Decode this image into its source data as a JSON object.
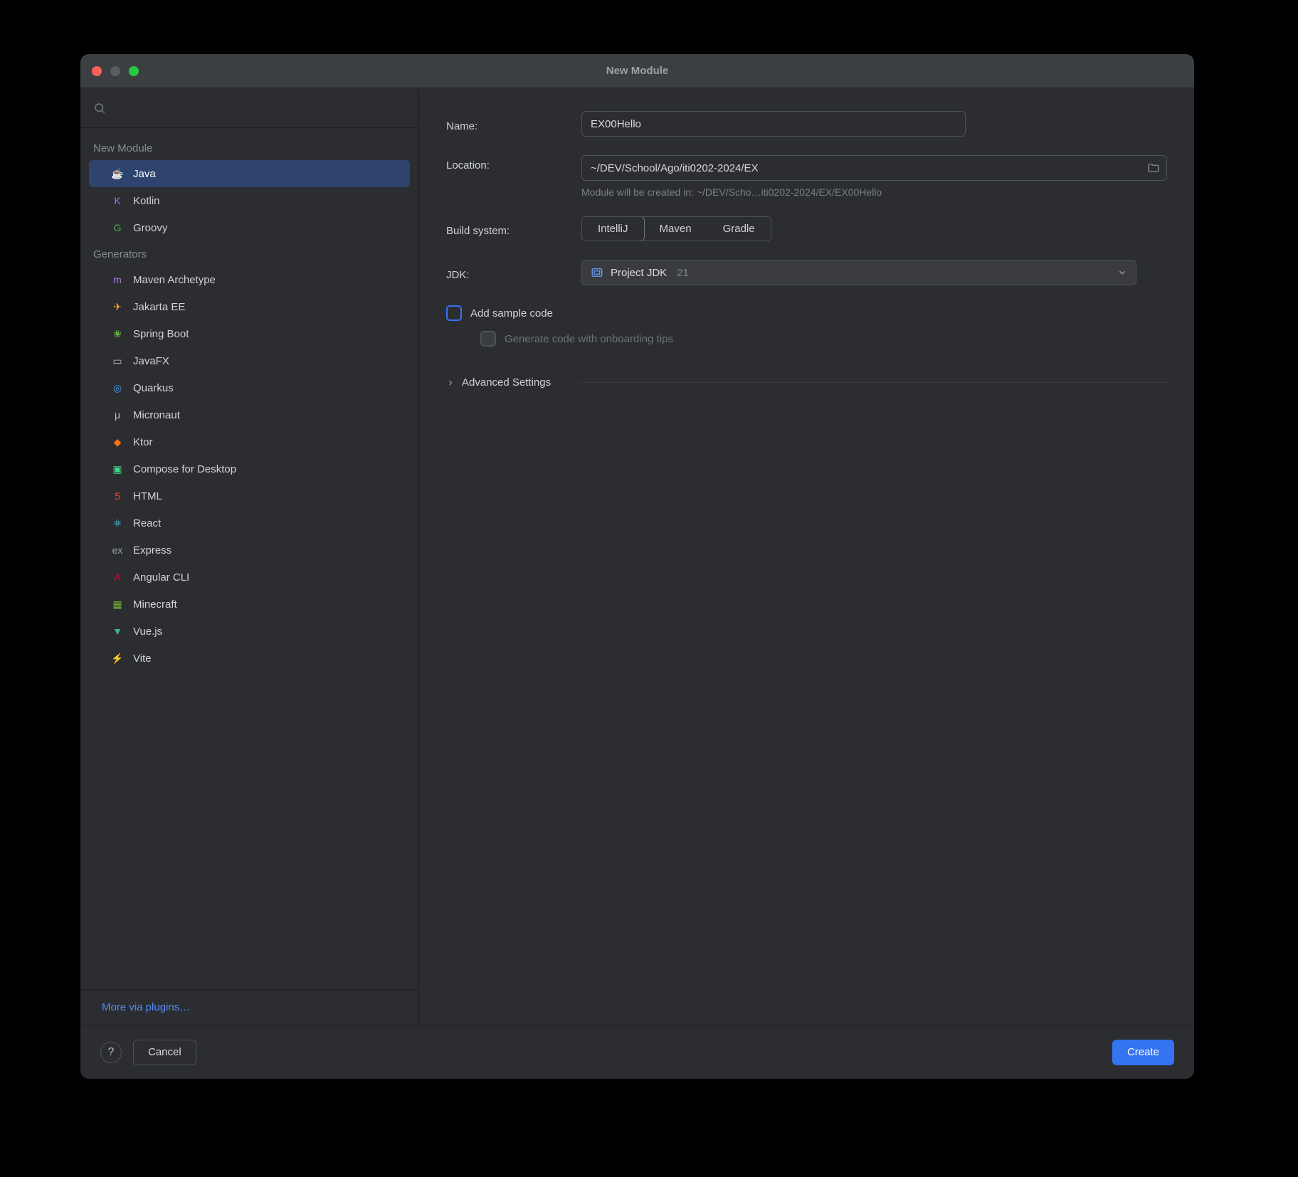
{
  "window": {
    "title": "New Module"
  },
  "sidebar": {
    "sections": [
      {
        "header": "New Module",
        "items": [
          {
            "label": "Java",
            "icon": "java-icon",
            "selected": true,
            "color": "#c97c4a"
          },
          {
            "label": "Kotlin",
            "icon": "kotlin-icon",
            "selected": false,
            "color": "#a86ff0"
          },
          {
            "label": "Groovy",
            "icon": "groovy-icon",
            "selected": false,
            "color": "#4caf50"
          }
        ]
      },
      {
        "header": "Generators",
        "items": [
          {
            "label": "Maven Archetype",
            "icon": "maven-icon",
            "selected": false,
            "color": "#b07bdf"
          },
          {
            "label": "Jakarta EE",
            "icon": "jakarta-icon",
            "selected": false,
            "color": "#f0a638"
          },
          {
            "label": "Spring Boot",
            "icon": "spring-icon",
            "selected": false,
            "color": "#6db33f"
          },
          {
            "label": "JavaFX",
            "icon": "javafx-icon",
            "selected": false,
            "color": "#bcbec4"
          },
          {
            "label": "Quarkus",
            "icon": "quarkus-icon",
            "selected": false,
            "color": "#4695eb"
          },
          {
            "label": "Micronaut",
            "icon": "micronaut-icon",
            "selected": false,
            "color": "#bcbec4"
          },
          {
            "label": "Ktor",
            "icon": "ktor-icon",
            "selected": false,
            "color": "#f97316"
          },
          {
            "label": "Compose for Desktop",
            "icon": "compose-icon",
            "selected": false,
            "color": "#3ddc84"
          },
          {
            "label": "HTML",
            "icon": "html-icon",
            "selected": false,
            "color": "#e44d26"
          },
          {
            "label": "React",
            "icon": "react-icon",
            "selected": false,
            "color": "#61dafb"
          },
          {
            "label": "Express",
            "icon": "express-icon",
            "selected": false,
            "color": "#9aa0a6"
          },
          {
            "label": "Angular CLI",
            "icon": "angular-icon",
            "selected": false,
            "color": "#dd0031"
          },
          {
            "label": "Minecraft",
            "icon": "minecraft-icon",
            "selected": false,
            "color": "#70b237"
          },
          {
            "label": "Vue.js",
            "icon": "vue-icon",
            "selected": false,
            "color": "#41b883"
          },
          {
            "label": "Vite",
            "icon": "vite-icon",
            "selected": false,
            "color": "#bd34fe"
          }
        ]
      }
    ],
    "more_link": "More via plugins…"
  },
  "form": {
    "name": {
      "label": "Name:",
      "value": "EX00Hello"
    },
    "location": {
      "label": "Location:",
      "value": "~/DEV/School/Ago/iti0202-2024/EX",
      "hint": "Module will be created in: ~/DEV/Scho…iti0202-2024/EX/EX00Hello"
    },
    "build_system": {
      "label": "Build system:",
      "options": [
        {
          "label": "IntelliJ",
          "selected": true
        },
        {
          "label": "Maven",
          "selected": false
        },
        {
          "label": "Gradle",
          "selected": false
        }
      ]
    },
    "jdk": {
      "label": "JDK:",
      "value": "Project JDK",
      "version": "21"
    },
    "add_sample": {
      "label": "Add sample code",
      "checked": false
    },
    "onboarding_tips": {
      "label": "Generate code with onboarding tips",
      "checked": false,
      "enabled": false
    },
    "advanced": {
      "label": "Advanced Settings",
      "expanded": false
    }
  },
  "footer": {
    "cancel": "Cancel",
    "create": "Create"
  }
}
